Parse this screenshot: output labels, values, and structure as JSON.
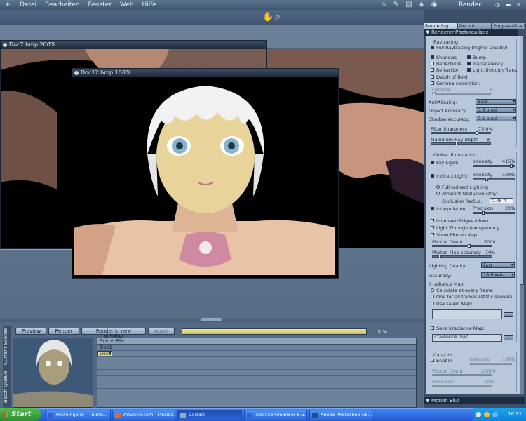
{
  "menubar": {
    "logo_icon": "carrara-logo-icon",
    "items": [
      "Datei",
      "Bearbeiten",
      "Fenster",
      "Web",
      "Hilfe"
    ],
    "title": "Render"
  },
  "toolbar": {
    "icons": [
      "hand-icon",
      "magnifier-icon"
    ]
  },
  "windows": {
    "doc7": {
      "title": "Doc7.bmp 200%"
    },
    "doc12": {
      "title": "Doc12.bmp 100%"
    }
  },
  "batch": {
    "buttons": {
      "preview": "Preview",
      "render": "Render",
      "render_new": "Render in new window",
      "abort": "Abort"
    },
    "progress_pct": "100%",
    "progress_value": 1.0,
    "tabs": {
      "current": "Current Scenes",
      "queue": "Batch Queue"
    },
    "table_header": "Scene File",
    "rows": [
      "Doc1",
      "Doc8",
      "",
      "",
      "",
      "",
      "",
      ""
    ]
  },
  "render_panel": {
    "tabs": [
      "Rendering",
      "Output",
      "Progress/Statist"
    ],
    "renderer_label": "Renderer",
    "renderer_value": "Photorealistic",
    "raytracing": {
      "title": "Raytracing",
      "full": "Full Raytracing (higher Quality)",
      "shadows": "Shadows",
      "bump": "Bump",
      "reflections": "Reflections",
      "transparency": "Transparency",
      "refraction": "Refraction",
      "light_through": "Light through Trans.",
      "dof": "Depth of field",
      "gamma": "Gamma correction:",
      "gamma_label": "Gamma",
      "gamma_value": "1.8",
      "aa_label": "AntiAliasing:",
      "aa_value": "Best",
      "obj_label": "Object Accuracy:",
      "obj_value": "0.5 pixel",
      "shadow_label": "Shadow Accuracy:",
      "shadow_value": "0.5 pixel",
      "filter_label": "Filter Sharpness",
      "filter_value": "75.0%",
      "filter_level": 0.75,
      "ray_label": "Maximum Ray Depth",
      "ray_value": "8",
      "ray_level": 0.4
    },
    "gi": {
      "title": "Global Illumination",
      "sky": "Sky Light:",
      "sky_int_label": "Intensity",
      "sky_int_value": "415%",
      "sky_level": 0.9,
      "indirect": "Indirect Light:",
      "ind_int_label": "Intensity",
      "ind_int_value": "100%",
      "ind_level": 0.3,
      "full_indirect": "Full Indirect Lighting",
      "ambient": "Ambient Occlusion Only",
      "occ_label": "Occlusion Radius:",
      "occ_value": "0.08 ft",
      "interp": "Interpolation:",
      "prec_label": "Precision",
      "prec_value": "20%",
      "prec_level": 0.2,
      "improved": "Improved Edges (slow)",
      "light_trans": "Light Through transparency",
      "show_photon": "Show Photon Map",
      "photon_label": "Photon Count",
      "photon_value": "5000",
      "photon_level": 0.6,
      "pm_acc_label": "Photon Map accuracy",
      "pm_acc_value": "10%",
      "pm_acc_level": 0.1,
      "lq_label": "Lighting Quality:",
      "lq_value": "Fast",
      "acc_label": "Accuracy:",
      "acc_value": "16 Pixels",
      "irr_title": "Irradiance Map:",
      "calc_every": "Calculate at every frame",
      "one_all": "One for all frames (static scenes)",
      "use_saved": "Use saved Map:",
      "save_irr": "Save irradiance Map:",
      "irr_map": "irradiance map"
    },
    "caustics": {
      "title": "Caustics",
      "enable": "Enable",
      "intensity_label": "Intensity",
      "intensity_value": "100%",
      "photon_label": "Photon Count",
      "photon_value": "20000",
      "filter_label": "Filter Size",
      "filter_value": "10%"
    },
    "motion_blur": "Motion Blur"
  },
  "taskbar": {
    "start": "Start",
    "tasks": [
      {
        "label": "Posteingang - Thund...",
        "color": "#3a5ec4"
      },
      {
        "label": "ArtZone.com - Mozilla...",
        "color": "#e66a1f"
      },
      {
        "label": "Carrara",
        "color": "#9aa8bc"
      },
      {
        "label": "Total Commander 6.5...",
        "color": "#2d6cc0"
      },
      {
        "label": "Adobe Photoshop CS...",
        "color": "#2a4a8c"
      }
    ],
    "clock": "16:21"
  }
}
